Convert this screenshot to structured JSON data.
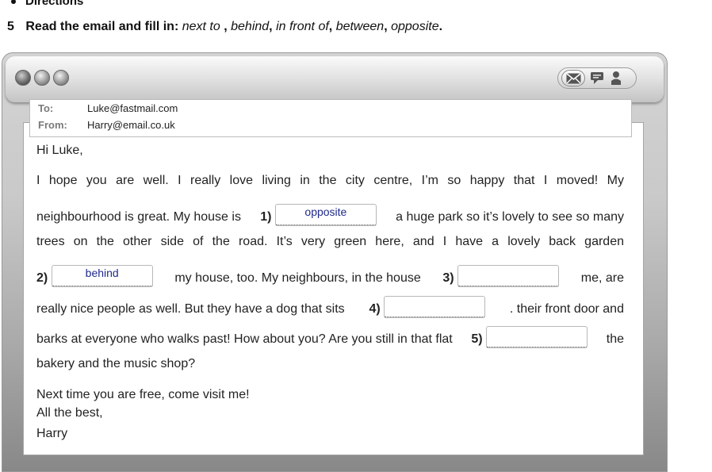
{
  "header": {
    "bullet_text": "Directions",
    "exercise_number": "5",
    "instruction_bold": "Read the email and fill in:",
    "words": [
      "next to",
      "behind",
      "in front of",
      "between",
      "opposite"
    ],
    "word_separator": ",",
    "final_period": "."
  },
  "email": {
    "to_label": "To:",
    "to_value": "Luke@fastmail.com",
    "from_label": "From:",
    "from_value": "Harry@email.co.uk",
    "greeting": "Hi Luke,",
    "line1": "I hope you are well. I really love living in the city centre, I’m so happy that I moved! My",
    "line2_a": "neighbourhood is great. My house is",
    "line2_b": "a huge park so it’s lovely to see so many",
    "line3": "trees on the other side of the road. It’s very green here, and I have a lovely back garden",
    "line4_b": "my house, too. My neighbours, in the house",
    "line4_c": "me, are",
    "line5_a": "really nice people as well. But they have a dog that sits",
    "line5_b": ". their front door and",
    "line6_a": "barks at everyone who walks past! How about you? Are you still in that flat",
    "line6_b": "the",
    "line7": "bakery and the music shop?",
    "closing1": "Next time you are free, come visit me!",
    "closing2": "All the best,",
    "signature": "Harry",
    "gap_numbers": [
      "1)",
      "2)",
      "3)",
      "4)",
      "5)"
    ],
    "answers": [
      "opposite",
      "behind",
      "",
      "",
      ""
    ]
  },
  "icons": [
    "window-close-icon",
    "window-minimize-icon",
    "window-zoom-icon",
    "mail-icon",
    "chat-icon",
    "user-icon"
  ]
}
